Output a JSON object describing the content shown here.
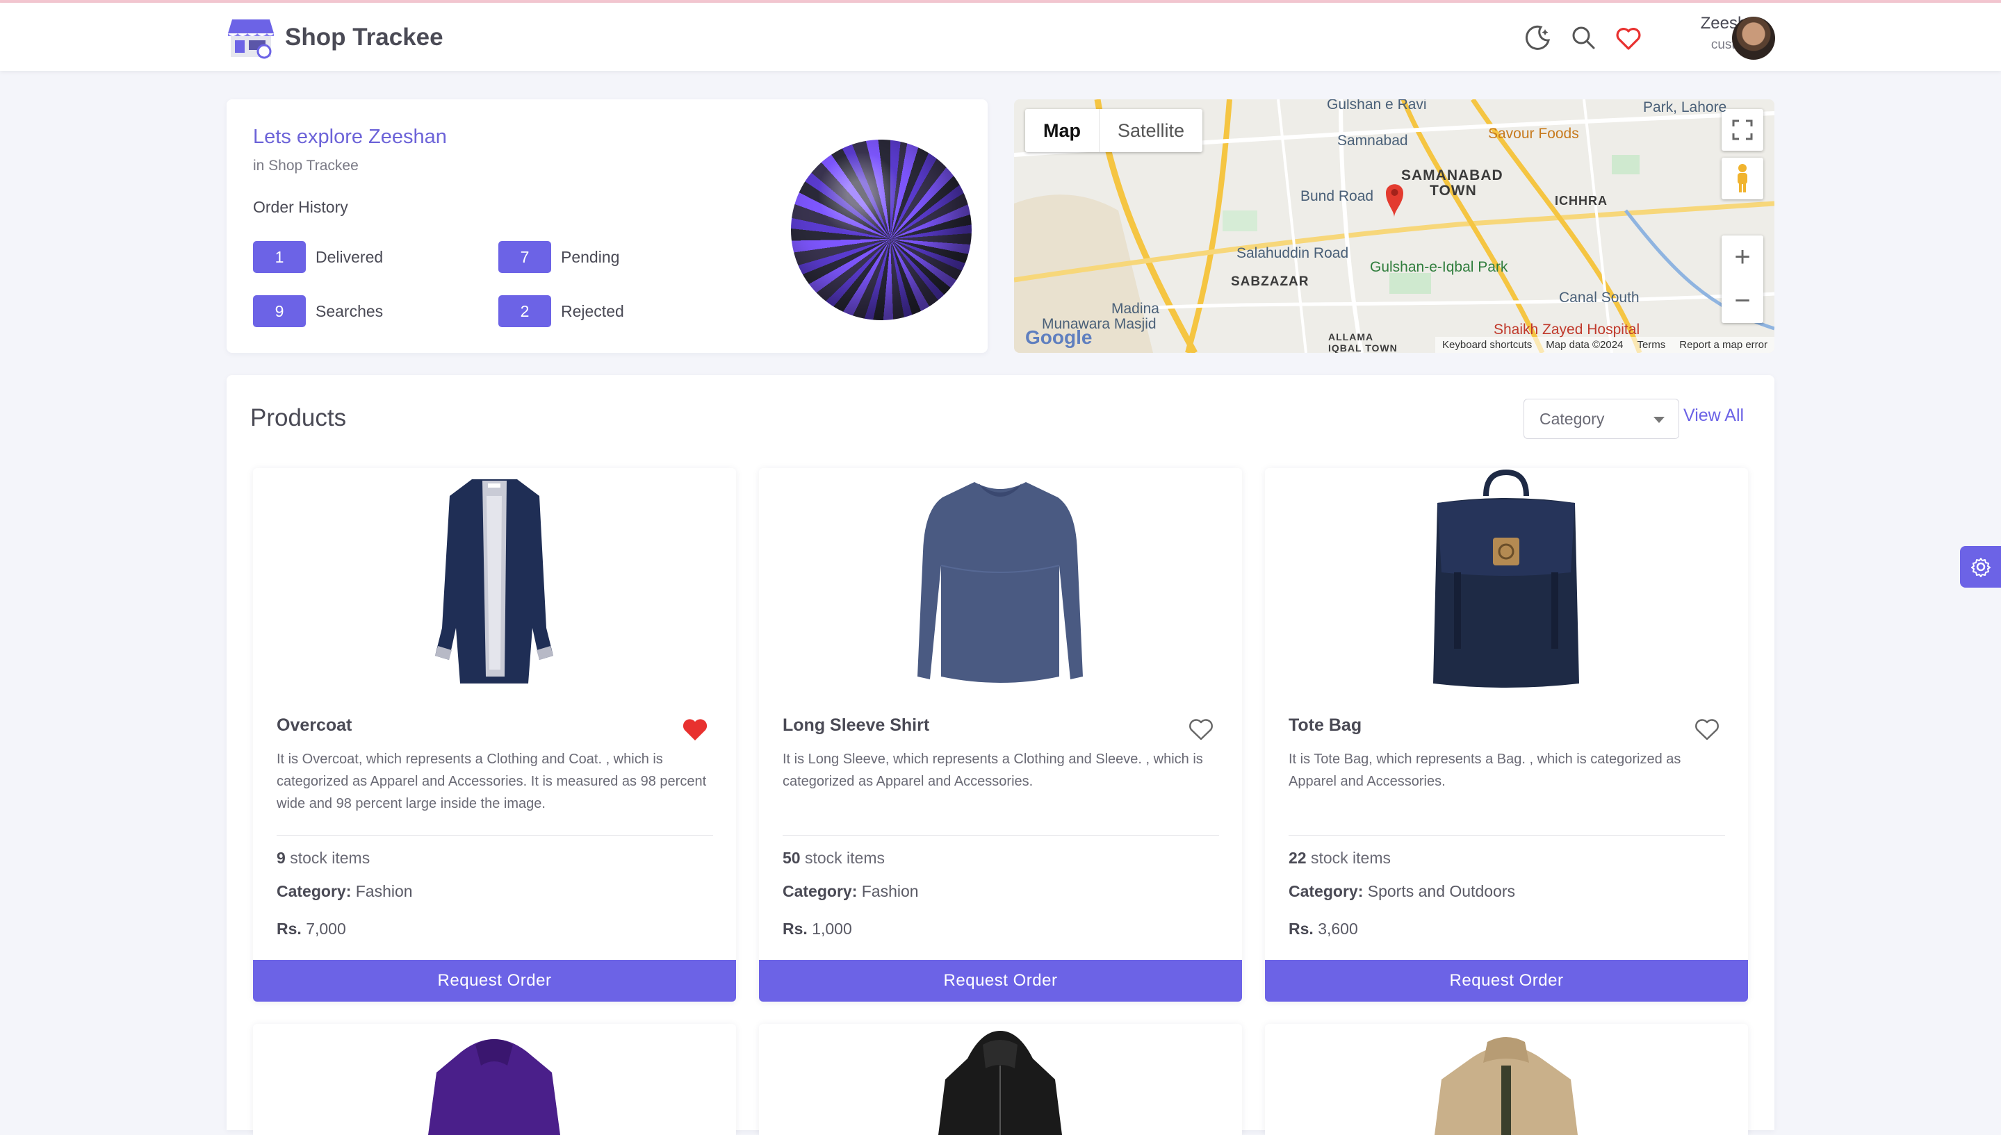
{
  "header": {
    "brand": "Shop Trackee",
    "user_name": "Zeeshan",
    "user_role": "customer",
    "icons": [
      "moon-icon",
      "search-icon",
      "heart-icon"
    ]
  },
  "welcome": {
    "title": "Lets explore Zeeshan",
    "subtitle": "in Shop Trackee",
    "order_history_label": "Order History",
    "stats": [
      {
        "count": "1",
        "label": "Delivered"
      },
      {
        "count": "7",
        "label": "Pending"
      },
      {
        "count": "9",
        "label": "Searches"
      },
      {
        "count": "2",
        "label": "Rejected"
      }
    ]
  },
  "map": {
    "tabs": [
      "Map",
      "Satellite"
    ],
    "labels": {
      "gulshan_ravi": "Gulshan e Ravi",
      "park_lahore": "Park, Lahore",
      "samnabad": "Samnabad",
      "savour": "Savour Foods",
      "samanabad_town": "SAMANABAD",
      "town": "TOWN",
      "bund_road": "Bund Road",
      "ichhra": "ICHHRA",
      "salahuddin": "Salahuddin Road",
      "sabzazar": "SABZAZAR",
      "gulshan_iqbal": "Gulshan-e-Iqbal Park",
      "canal_south": "Canal South",
      "madina": "Madina",
      "munawara": "Munawara Masjid",
      "shaikh_zayed": "Shaikh Zayed Hospital",
      "allama": "ALLAMA",
      "iqbal_town": "IQBAL TOWN"
    },
    "footer": [
      "Keyboard shortcuts",
      "Map data ©2024",
      "Terms",
      "Report a map error"
    ],
    "google": "Google"
  },
  "products": {
    "title": "Products",
    "category_select": "Category",
    "view_all": "View All",
    "request_label": "Request Order",
    "stock_suffix": "stock items",
    "category_prefix": "Category:",
    "price_prefix": "Rs.",
    "items": [
      {
        "name": "Overcoat",
        "favorited": true,
        "description": "It is Overcoat, which represents a Clothing and Coat. , which is categorized as Apparel and Accessories. It is measured as 98 percent wide and 98 percent large inside the image.",
        "stock": "9",
        "category": "Fashion",
        "price": "7,000"
      },
      {
        "name": "Long Sleeve Shirt",
        "favorited": false,
        "description": "It is Long Sleeve, which represents a Clothing and Sleeve. , which is categorized as Apparel and Accessories.",
        "stock": "50",
        "category": "Fashion",
        "price": "1,000"
      },
      {
        "name": "Tote Bag",
        "favorited": false,
        "description": "It is Tote Bag, which represents a Bag. , which is categorized as Apparel and Accessories.",
        "stock": "22",
        "category": "Sports and Outdoors",
        "price": "3,600"
      }
    ]
  },
  "colors": {
    "accent": "#6c63e6",
    "heart_red": "#e8312f",
    "background": "#f4f5fa"
  }
}
